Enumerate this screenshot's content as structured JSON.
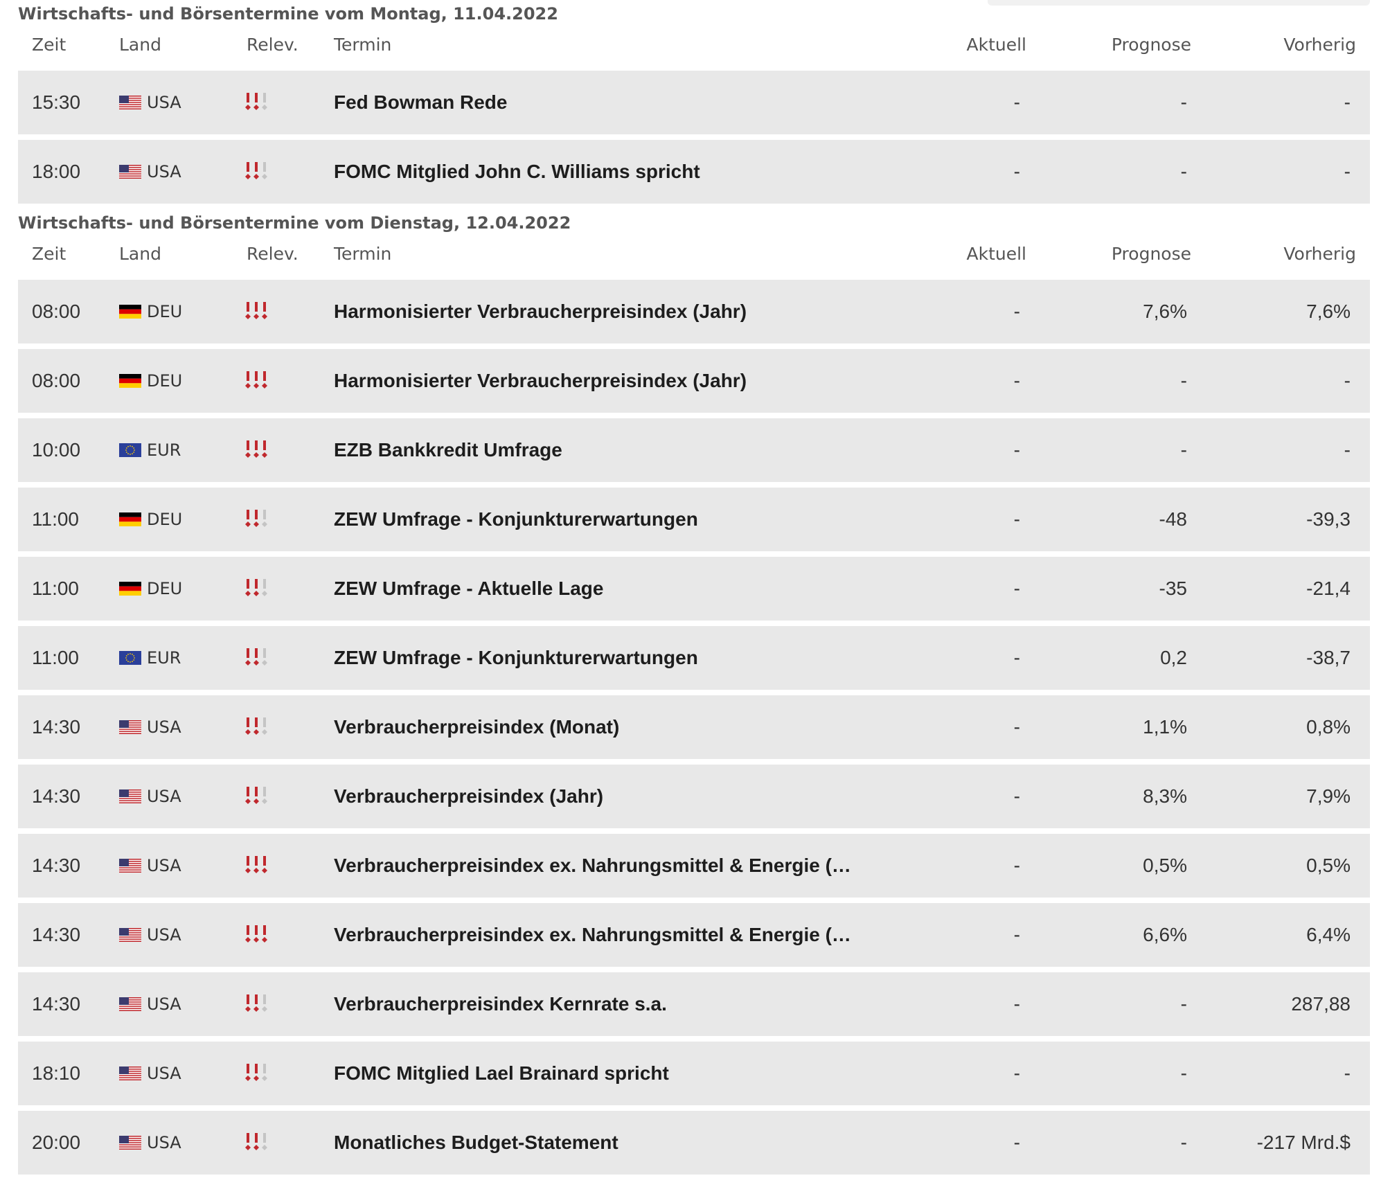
{
  "sections": [
    {
      "title": "Wirtschafts- und Börsentermine vom Montag, 11.04.2022",
      "headers": {
        "time": "Zeit",
        "country": "Land",
        "relevance": "Relev.",
        "term": "Termin",
        "actual": "Aktuell",
        "forecast": "Prognose",
        "previous": "Vorherig"
      },
      "rows": [
        {
          "time": "15:30",
          "country": "USA",
          "flag": "us-flag-icon",
          "relevance": 2,
          "term": "Fed Bowman Rede",
          "actual": "-",
          "forecast": "-",
          "previous": "-"
        },
        {
          "time": "18:00",
          "country": "USA",
          "flag": "us-flag-icon",
          "relevance": 2,
          "term": "FOMC Mitglied John C. Williams spricht",
          "actual": "-",
          "forecast": "-",
          "previous": "-"
        }
      ]
    },
    {
      "title": "Wirtschafts- und Börsentermine vom Dienstag, 12.04.2022",
      "headers": {
        "time": "Zeit",
        "country": "Land",
        "relevance": "Relev.",
        "term": "Termin",
        "actual": "Aktuell",
        "forecast": "Prognose",
        "previous": "Vorherig"
      },
      "rows": [
        {
          "time": "08:00",
          "country": "DEU",
          "flag": "de-flag-icon",
          "relevance": 3,
          "term": "Harmonisierter Verbraucherpreisindex (Jahr)",
          "actual": "-",
          "forecast": "7,6%",
          "previous": "7,6%"
        },
        {
          "time": "08:00",
          "country": "DEU",
          "flag": "de-flag-icon",
          "relevance": 3,
          "term": "Harmonisierter Verbraucherpreisindex (Jahr)",
          "actual": "-",
          "forecast": "-",
          "previous": "-"
        },
        {
          "time": "10:00",
          "country": "EUR",
          "flag": "eu-flag-icon",
          "relevance": 3,
          "term": "EZB Bankkredit Umfrage",
          "actual": "-",
          "forecast": "-",
          "previous": "-"
        },
        {
          "time": "11:00",
          "country": "DEU",
          "flag": "de-flag-icon",
          "relevance": 2,
          "term": "ZEW Umfrage - Konjunkturerwartungen",
          "actual": "-",
          "forecast": "-48",
          "previous": "-39,3"
        },
        {
          "time": "11:00",
          "country": "DEU",
          "flag": "de-flag-icon",
          "relevance": 2,
          "term": "ZEW Umfrage - Aktuelle Lage",
          "actual": "-",
          "forecast": "-35",
          "previous": "-21,4"
        },
        {
          "time": "11:00",
          "country": "EUR",
          "flag": "eu-flag-icon",
          "relevance": 2,
          "term": "ZEW Umfrage - Konjunkturerwartungen",
          "actual": "-",
          "forecast": "0,2",
          "previous": "-38,7"
        },
        {
          "time": "14:30",
          "country": "USA",
          "flag": "us-flag-icon",
          "relevance": 2,
          "term": "Verbraucherpreisindex (Monat)",
          "actual": "-",
          "forecast": "1,1%",
          "previous": "0,8%"
        },
        {
          "time": "14:30",
          "country": "USA",
          "flag": "us-flag-icon",
          "relevance": 2,
          "term": "Verbraucherpreisindex (Jahr)",
          "actual": "-",
          "forecast": "8,3%",
          "previous": "7,9%"
        },
        {
          "time": "14:30",
          "country": "USA",
          "flag": "us-flag-icon",
          "relevance": 3,
          "term": "Verbraucherpreisindex ex. Nahrungsmittel & Energie (…",
          "actual": "-",
          "forecast": "0,5%",
          "previous": "0,5%"
        },
        {
          "time": "14:30",
          "country": "USA",
          "flag": "us-flag-icon",
          "relevance": 3,
          "term": "Verbraucherpreisindex ex. Nahrungsmittel & Energie (J…",
          "actual": "-",
          "forecast": "6,6%",
          "previous": "6,4%"
        },
        {
          "time": "14:30",
          "country": "USA",
          "flag": "us-flag-icon",
          "relevance": 2,
          "term": "Verbraucherpreisindex Kernrate s.a.",
          "actual": "-",
          "forecast": "-",
          "previous": "287,88"
        },
        {
          "time": "18:10",
          "country": "USA",
          "flag": "us-flag-icon",
          "relevance": 2,
          "term": "FOMC Mitglied Lael Brainard spricht",
          "actual": "-",
          "forecast": "-",
          "previous": "-"
        },
        {
          "time": "20:00",
          "country": "USA",
          "flag": "us-flag-icon",
          "relevance": 2,
          "term": "Monatliches Budget-Statement",
          "actual": "-",
          "forecast": "-",
          "previous": "-217 Mrd.$"
        }
      ]
    }
  ],
  "colors": {
    "row_bg": "#e8e8e8",
    "relevance_active": "#c0282d",
    "relevance_inactive": "#c4c4c4",
    "header_text": "#555555"
  }
}
